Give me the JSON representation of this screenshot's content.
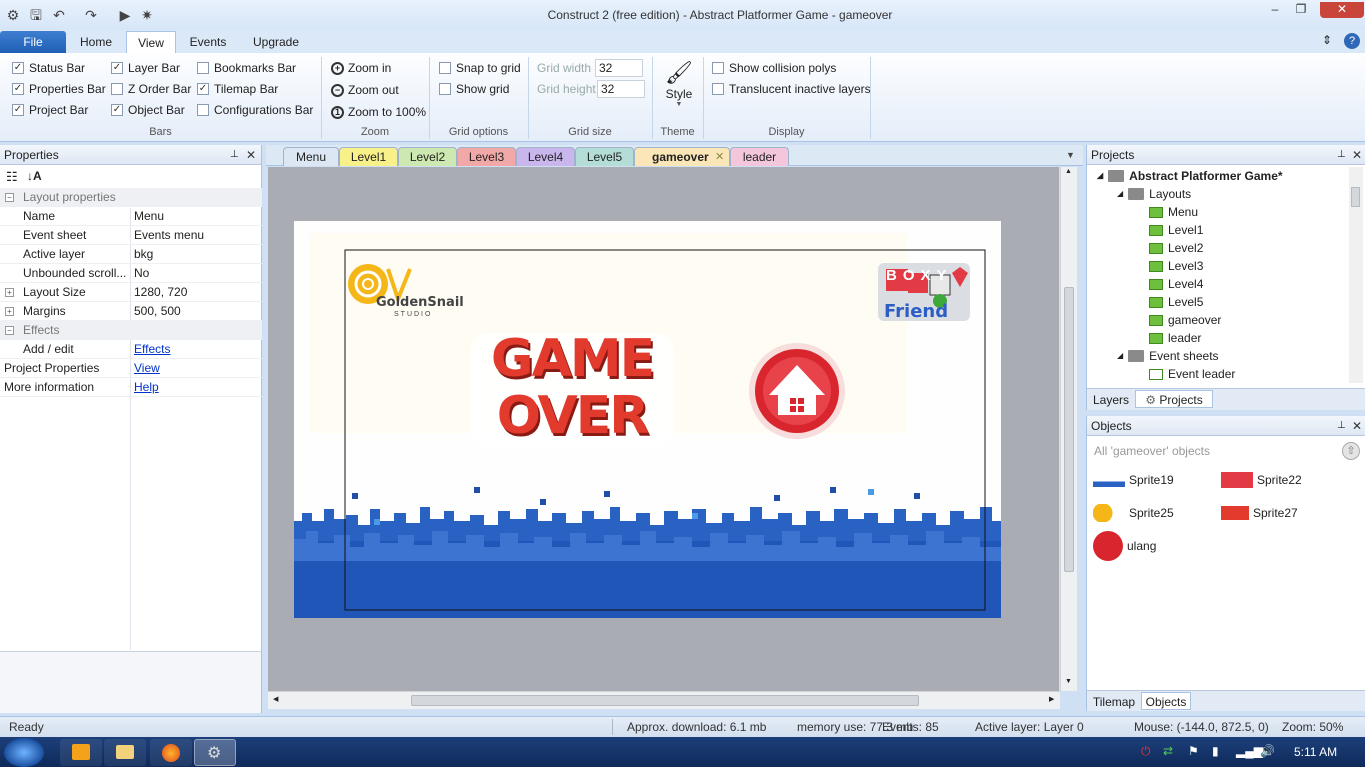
{
  "window": {
    "title": "Construct 2  (free edition) - Abstract Platformer Game - gameover",
    "controls": {
      "minimize": "–",
      "restore": "❐",
      "close": "✕"
    }
  },
  "ribbon_tabs": [
    "File",
    "Home",
    "View",
    "Events",
    "Upgrade"
  ],
  "ribbon": {
    "bars": {
      "label": "Bars",
      "items": [
        {
          "label": "Status Bar",
          "checked": true
        },
        {
          "label": "Properties Bar",
          "checked": true
        },
        {
          "label": "Project Bar",
          "checked": true
        },
        {
          "label": "Layer Bar",
          "checked": true
        },
        {
          "label": "Z Order Bar",
          "checked": false
        },
        {
          "label": "Object Bar",
          "checked": true
        },
        {
          "label": "Bookmarks Bar",
          "checked": false
        },
        {
          "label": "Tilemap Bar",
          "checked": true
        },
        {
          "label": "Configurations Bar",
          "checked": false
        }
      ]
    },
    "zoom": {
      "label": "Zoom",
      "items": [
        "Zoom in",
        "Zoom out",
        "Zoom to 100%"
      ]
    },
    "grid_options": {
      "label": "Grid options",
      "snap": "Snap to grid",
      "show": "Show grid"
    },
    "grid_size": {
      "label": "Grid size",
      "width_label": "Grid width",
      "width": "32",
      "height_label": "Grid height",
      "height": "32"
    },
    "theme": {
      "label": "Theme",
      "style": "Style"
    },
    "display": {
      "label": "Display",
      "collision": "Show collision polys",
      "translucent": "Translucent inactive layers"
    }
  },
  "properties": {
    "title": "Properties",
    "rows": [
      {
        "key": "Layout properties",
        "value": "",
        "type": "cat"
      },
      {
        "key": "Name",
        "value": "Menu"
      },
      {
        "key": "Event sheet",
        "value": "Events menu"
      },
      {
        "key": "Active layer",
        "value": "bkg"
      },
      {
        "key": "Unbounded scroll...",
        "value": "No"
      },
      {
        "key": "Layout Size",
        "value": "1280, 720",
        "expand": true
      },
      {
        "key": "Margins",
        "value": "500, 500",
        "expand": true
      },
      {
        "key": "Effects",
        "value": "",
        "type": "cat"
      },
      {
        "key": "Add / edit",
        "value": "Effects",
        "link": true
      },
      {
        "key": "Project Properties",
        "value": "View",
        "link": true,
        "top": true
      },
      {
        "key": "More information",
        "value": "Help",
        "link": true,
        "top": true
      }
    ]
  },
  "doc_tabs": [
    {
      "label": "Menu",
      "color": "#dde6f3"
    },
    {
      "label": "Level1",
      "color": "#f8f18a"
    },
    {
      "label": "Level2",
      "color": "#cde8b0"
    },
    {
      "label": "Level3",
      "color": "#f3a8a8"
    },
    {
      "label": "Level4",
      "color": "#c9b6ec"
    },
    {
      "label": "Level5",
      "color": "#b5ddd8"
    },
    {
      "label": "gameover",
      "color": "#fbe6b8",
      "active": true
    },
    {
      "label": "leader",
      "color": "#f3c6dc"
    }
  ],
  "canvas": {
    "logo_left": "GoldenSnail",
    "logo_left_sub": "STUDIO",
    "logo_right_top": "BOXY",
    "logo_right_bottom": "Friend",
    "game_over_line1": "GAME",
    "game_over_line2": "OVER"
  },
  "projects": {
    "title": "Projects",
    "root": "Abstract Platformer Game*",
    "layouts_label": "Layouts",
    "layouts": [
      "Menu",
      "Level1",
      "Level2",
      "Level3",
      "Level4",
      "Level5",
      "gameover",
      "leader"
    ],
    "event_sheets_label": "Event sheets",
    "event_sheets": [
      "Event leader"
    ],
    "tabs": [
      "Layers",
      "Projects"
    ]
  },
  "objects": {
    "title": "Objects",
    "filter": "All 'gameover' objects",
    "items": [
      "Sprite19",
      "Sprite22",
      "Sprite25",
      "Sprite27",
      "ulang"
    ],
    "tabs": [
      "Tilemap",
      "Objects"
    ]
  },
  "status": {
    "ready": "Ready",
    "download": "Approx. download: 6.1 mb",
    "memory": "memory use: 77.3 mb",
    "events": "Events: 85",
    "layer": "Active layer: Layer 0",
    "mouse": "Mouse: (-144.0, 872.5, 0)",
    "zoom": "Zoom: 50%"
  },
  "taskbar": {
    "time": "5:11 AM"
  },
  "colors": {
    "accent": "#1f5fb5",
    "ribbon_bg": "#dbe8f7",
    "canvas_bg": "#a9acb3"
  }
}
